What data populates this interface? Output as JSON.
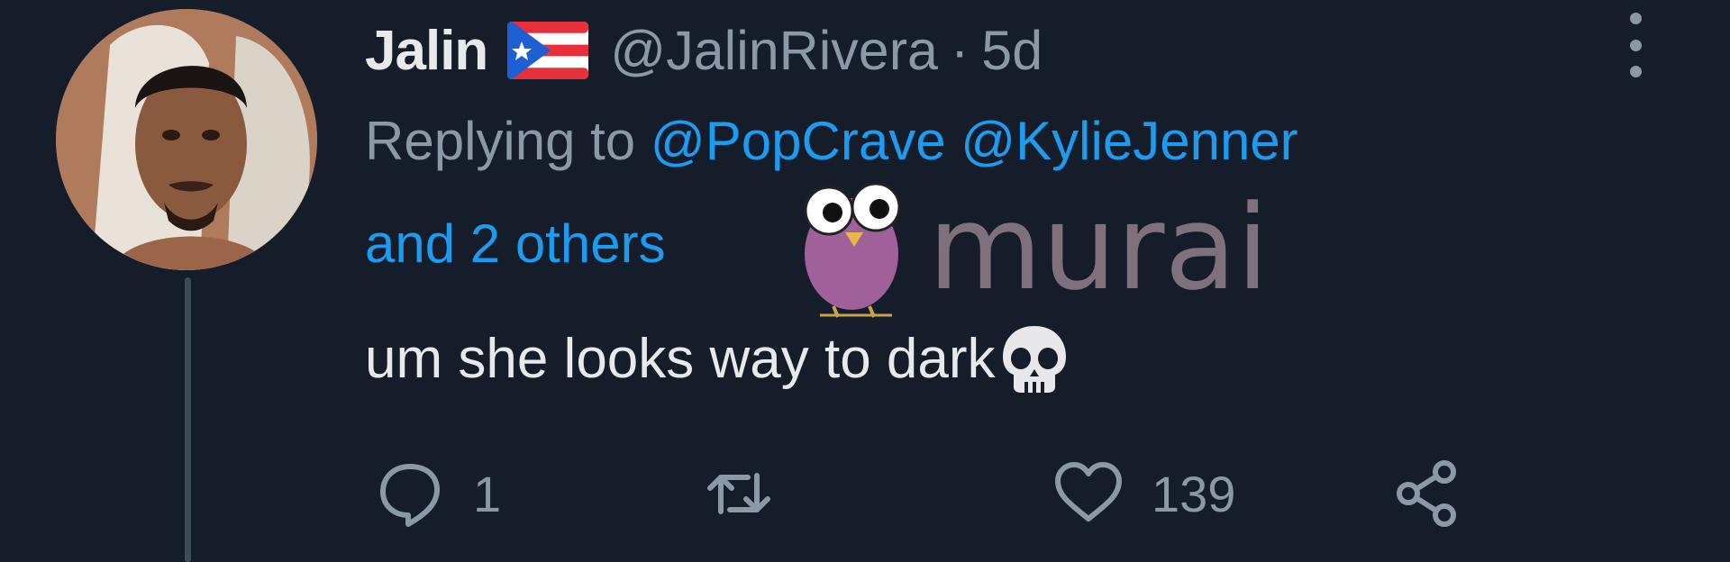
{
  "author": {
    "display_name": "Jalin",
    "flag_icon": "puerto-rico-flag-icon",
    "handle": "@JalinRivera",
    "separator": "·",
    "time_ago": "5d"
  },
  "reply_context": {
    "prefix": "Replying to ",
    "mentions": [
      "@PopCrave",
      "@KylieJenner"
    ],
    "others": "and 2 others"
  },
  "tweet": {
    "text": "um she looks way to dark",
    "emoji_icon": "skull-emoji-icon"
  },
  "watermark": {
    "text": "murai",
    "icon": "owl-icon"
  },
  "actions": {
    "reply": {
      "icon": "reply-icon",
      "count": "1"
    },
    "retweet": {
      "icon": "retweet-icon",
      "count": ""
    },
    "like": {
      "icon": "heart-icon",
      "count": "139"
    },
    "share": {
      "icon": "share-icon"
    }
  },
  "colors": {
    "background": "#141d29",
    "primary_text": "#e7e9ea",
    "secondary_text": "#8b98a5",
    "link": "#1d9bf0",
    "thread_line": "#3d4a57"
  }
}
